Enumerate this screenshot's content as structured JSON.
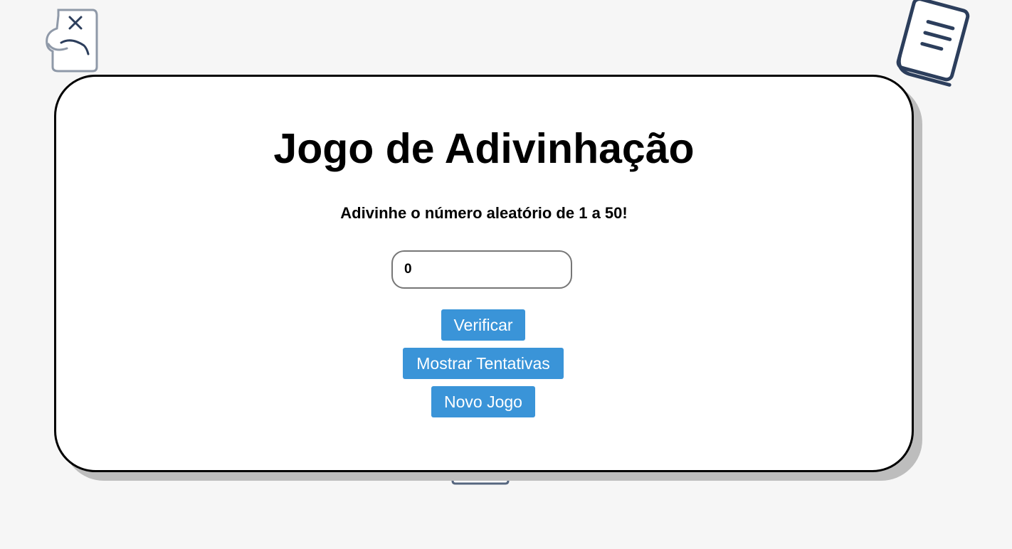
{
  "game": {
    "title": "Jogo de Adivinhação",
    "instruction": "Adivinhe o número aleatório de 1 a 50!",
    "guess_value": "0"
  },
  "buttons": {
    "verify_label": "Verificar",
    "show_attempts_label": "Mostrar Tentativas",
    "new_game_label": "Novo Jogo"
  },
  "decorations": {
    "top_left_icon": "jar-icon",
    "top_right_icon": "book-icon",
    "bottom_icon": "box-icon"
  },
  "colors": {
    "background": "#f6f6f6",
    "card": "#ffffff",
    "card_border": "#000000",
    "card_shadow": "#bdbdbd",
    "button": "#3a94d8",
    "button_text": "#ffffff",
    "icon_stroke": "#2c3e5c"
  }
}
